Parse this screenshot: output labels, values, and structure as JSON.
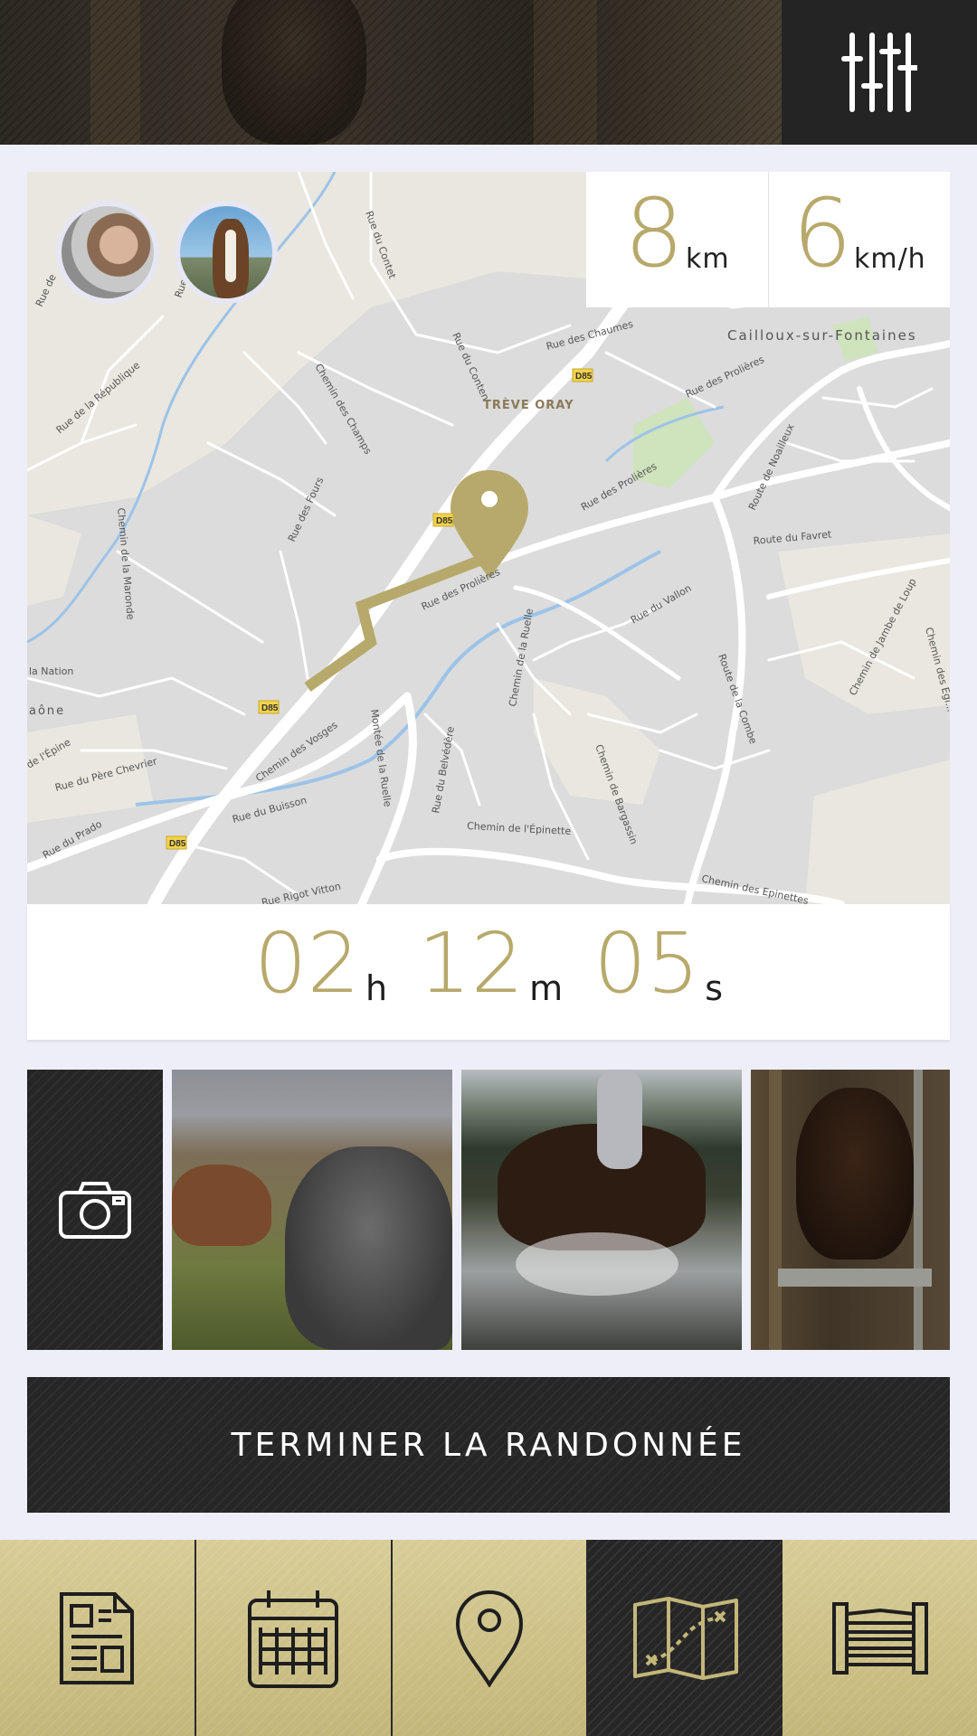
{
  "header": {
    "filter_icon": "sliders-icon"
  },
  "stats": {
    "distance_value": "8",
    "distance_unit": "km",
    "speed_value": "6",
    "speed_unit": "km/h"
  },
  "map": {
    "labels": {
      "place_cailloux": "Cailloux-sur-Fontaines",
      "place_treve": "TRÈVE ORAY",
      "rue_chaumes": "Rue des Chaumes",
      "rue_conten": "Rue du Conten",
      "rue_contet": "Rue du Contet",
      "rue_republique": "Rue de la République",
      "chemin_champs": "Chemin des Champs",
      "rue_prolieres_1": "Rue des Prolières",
      "rue_prolieres_2": "Rue des Prolières",
      "rue_prolieres_3": "Rue des Prolières",
      "route_noailleux": "Route de Noailleux",
      "route_favret": "Route du Favret",
      "rue_fours": "Rue des Fours",
      "chemin_maronde": "Chemin de la Maronde",
      "rue_vallon": "Rue du Vallon",
      "chemin_ruelle": "Chemin de la Ruelle",
      "route_combe": "Route de la Combe",
      "chemin_jambe": "Chemin de Jambe de Loup",
      "chemin_egl": "Chemin des Égl...",
      "la_nation": "la Nation",
      "saone": "aône",
      "epine": "de l'Épine",
      "rue_pere_chevrier": "Rue du Père Chevrier",
      "chemin_vosges": "Chemin des Vosges",
      "montee_ruelle": "Montée de la Ruelle",
      "rue_belvedere": "Rue du Belvédère",
      "chemin_bargassin": "Chemin de Bargassin",
      "rue_buisson": "Rue du Buisson",
      "rue_prado": "Rue du Prado",
      "chemin_epinette": "Chemin de l'Épinette",
      "chemin_epinettes": "Chemin des Epinettes",
      "rue_rigot": "Rue Rigot Vitton",
      "rue_short_1": "Rue",
      "rue_short_2": "Rue de",
      "d85": "D85"
    }
  },
  "timer": {
    "hours": "02",
    "hours_unit": "h",
    "minutes": "12",
    "minutes_unit": "m",
    "seconds": "05",
    "seconds_unit": "s"
  },
  "photos": {
    "add_icon": "camera-icon"
  },
  "finish_button": {
    "label": "TERMINER LA RANDONNÉE"
  },
  "nav": {
    "items": [
      {
        "icon": "document-icon"
      },
      {
        "icon": "calendar-icon"
      },
      {
        "icon": "location-pin-icon"
      },
      {
        "icon": "map-icon",
        "active": true
      },
      {
        "icon": "fence-icon"
      }
    ]
  },
  "colors": {
    "accent": "#b7a96b",
    "dark": "#262626",
    "nav_gold": "#cfc38a"
  }
}
